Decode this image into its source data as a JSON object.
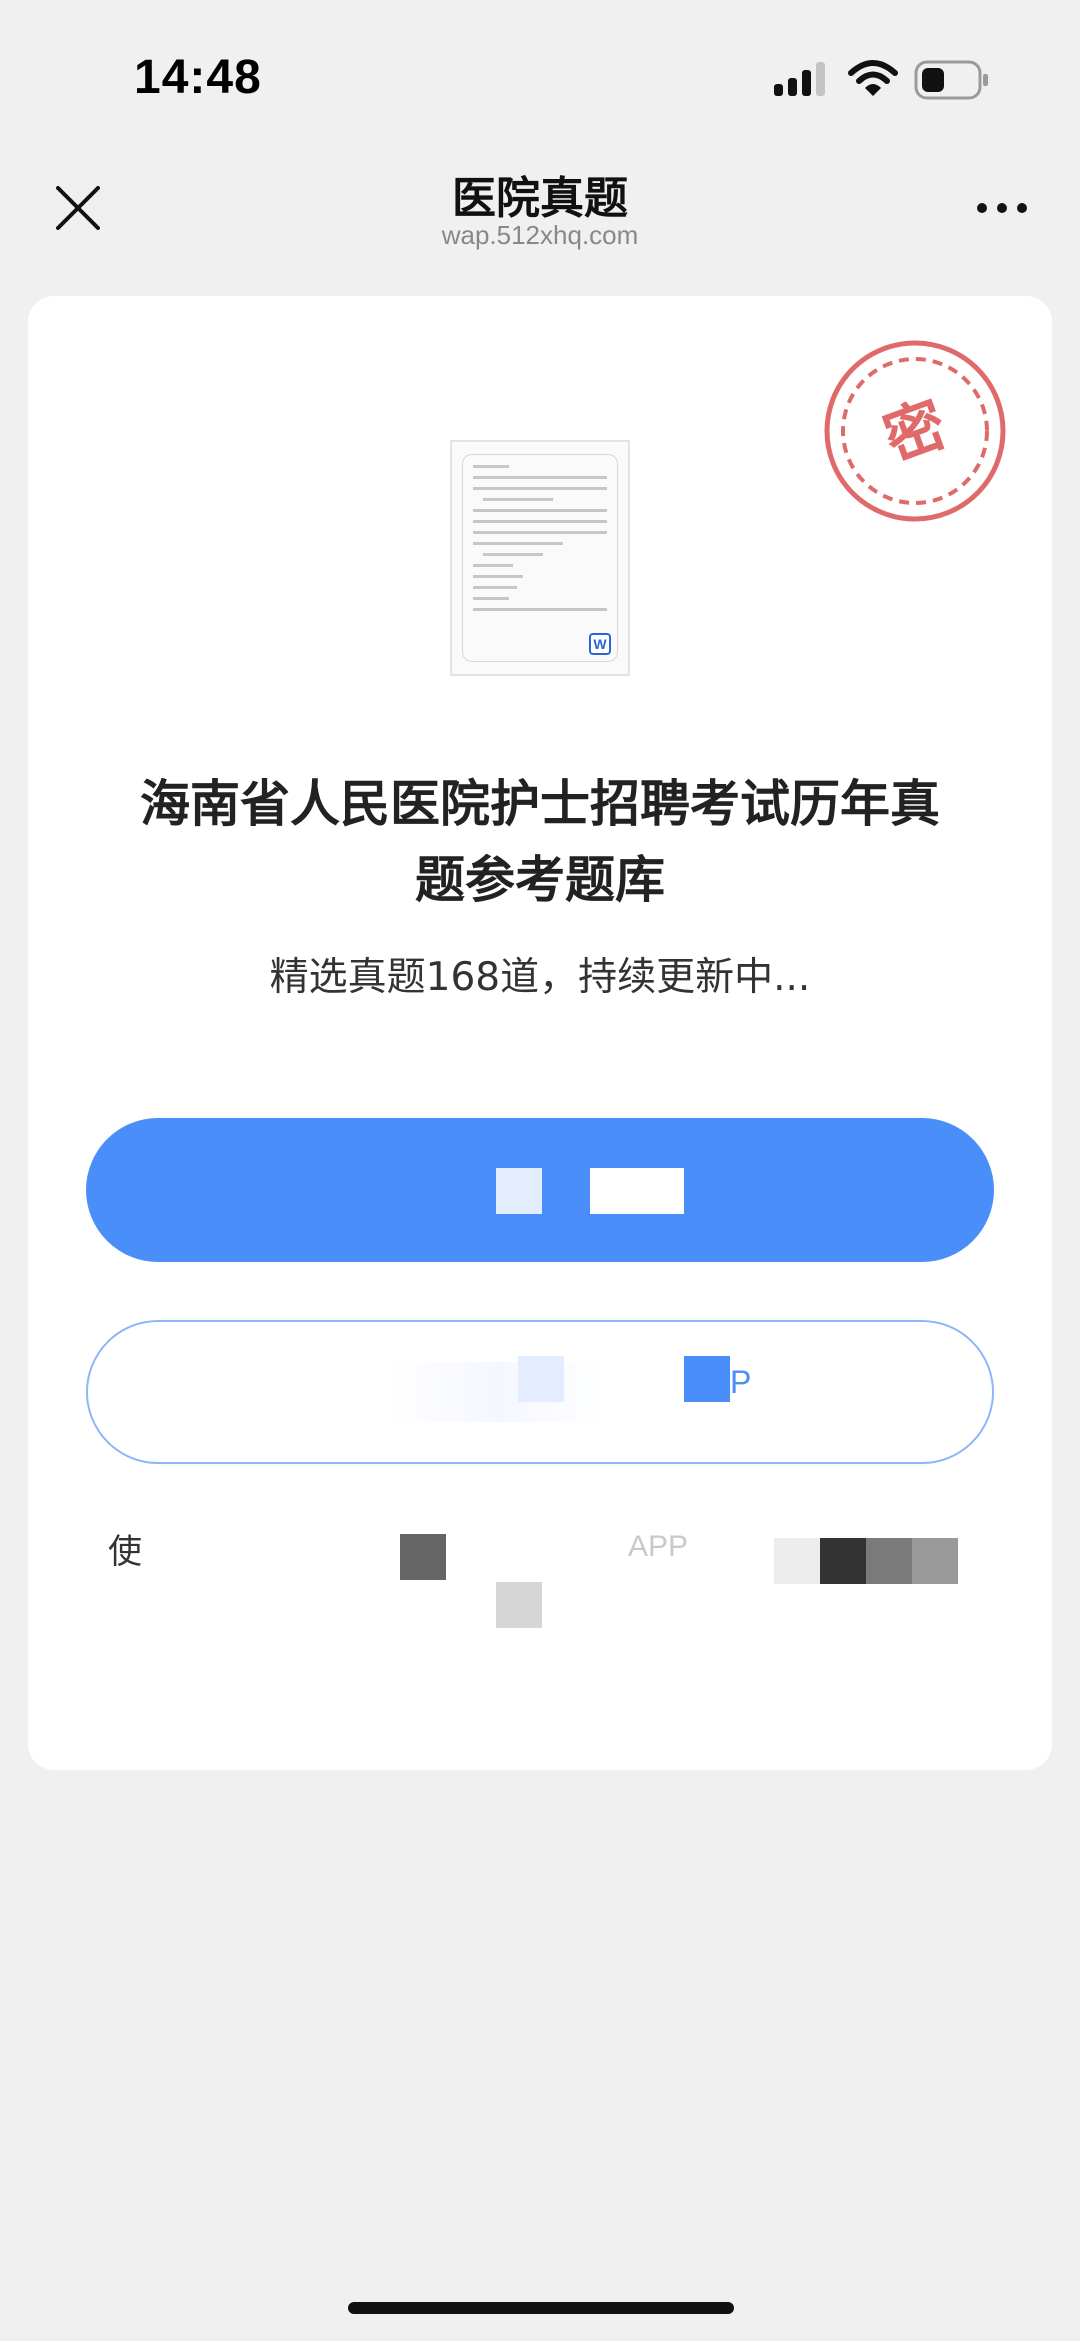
{
  "status_bar": {
    "time": "14:48",
    "icons": [
      "signal-icon",
      "wifi-icon",
      "battery-icon"
    ]
  },
  "nav": {
    "title": "医院真题",
    "url": "wap.512xhq.com",
    "left_icon": "close-icon",
    "right_icon": "more-icon"
  },
  "card": {
    "seal_text": "密",
    "doc_icon": "word-document-icon",
    "doc_badge": "W",
    "title": "海南省人民医院护士招聘考试历年真题参考题库",
    "subtitle": "精选真题168道，持续更新中...",
    "primary_button_label": "",
    "secondary_button_label": "",
    "secondary_fragment": "P",
    "note_lead": "使",
    "note_fragment": "APP"
  },
  "colors": {
    "accent": "#4a8ef9",
    "seal": "#e06a6a",
    "background": "#f0f0f0"
  }
}
